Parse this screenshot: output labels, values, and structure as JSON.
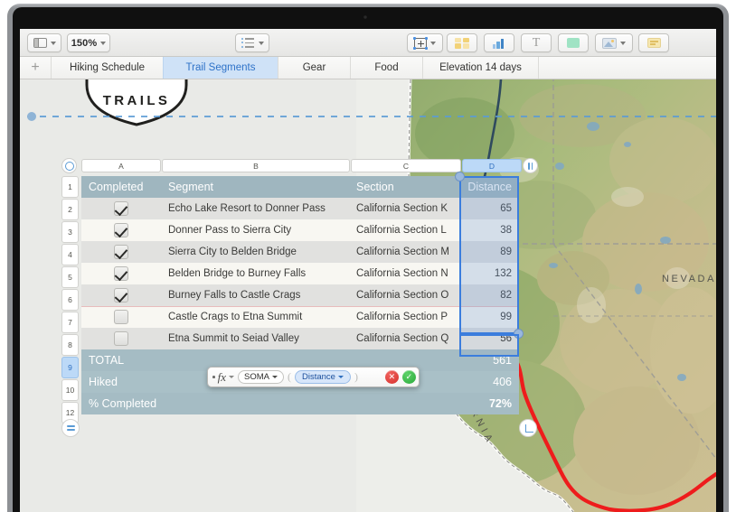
{
  "app": {
    "toolbar": {
      "view_label": "view-options",
      "zoom_value": "150%",
      "list_label": "format-list",
      "insert_label": "insert-object",
      "table_label": "Table",
      "chart_label": "Chart",
      "text_label": "T",
      "shape_label": "Shape",
      "media_label": "Media",
      "comment_label": "Comment"
    },
    "tabs": {
      "add_label": "+",
      "items": [
        {
          "label": "Hiking Schedule",
          "selected": false
        },
        {
          "label": "Trail Segments",
          "selected": true
        },
        {
          "label": "Gear",
          "selected": false
        },
        {
          "label": "Food",
          "selected": false
        },
        {
          "label": "Elevation 14 days",
          "selected": false
        }
      ]
    }
  },
  "logo": {
    "text": "TRAILS"
  },
  "table": {
    "column_headers": [
      "A",
      "B",
      "C",
      "D"
    ],
    "selected_column": "D",
    "row_numbers": [
      "1",
      "2",
      "3",
      "4",
      "5",
      "6",
      "7",
      "8",
      "9",
      "10",
      "12"
    ],
    "selected_row_number": "9",
    "headers": {
      "completed": "Completed",
      "segment": "Segment",
      "section": "Section",
      "distance": "Distance"
    },
    "rows": [
      {
        "completed": true,
        "segment": "Echo Lake Resort to Donner Pass",
        "section": "California Section K",
        "distance": "65"
      },
      {
        "completed": true,
        "segment": "Donner Pass to Sierra City",
        "section": "California Section L",
        "distance": "38"
      },
      {
        "completed": true,
        "segment": "Sierra City to Belden Bridge",
        "section": "California Section M",
        "distance": "89"
      },
      {
        "completed": true,
        "segment": "Belden Bridge to Burney Falls",
        "section": "California Section N",
        "distance": "132"
      },
      {
        "completed": true,
        "segment": "Burney Falls to Castle Crags",
        "section": "California Section O",
        "distance": "82"
      },
      {
        "completed": false,
        "segment": "Castle Crags to Etna Summit",
        "section": "California Section P",
        "distance": "99"
      },
      {
        "completed": false,
        "segment": "Etna Summit to Seiad Valley",
        "section": "California Section Q",
        "distance": "56"
      }
    ],
    "footers": [
      {
        "label": "TOTAL",
        "value": "561"
      },
      {
        "label": "Hiked",
        "value": "406"
      },
      {
        "label": "% Completed",
        "value": "72%"
      }
    ]
  },
  "formula_bar": {
    "fx_label": "fx",
    "function_name": "SOMA",
    "argument": "Distance",
    "open_paren": "(",
    "close_paren": ")",
    "cancel_label": "✕",
    "accept_label": "✓"
  },
  "map": {
    "state_label_california": "CALIFORNIA",
    "state_label_nevada": "NEVADA",
    "route_color": "#ee1c1c"
  },
  "colors": {
    "header_fill": "#9fb6bf",
    "footer_fill": "#a5bcc4",
    "row_odd": "#e1e1df",
    "row_even": "#f8f7f2",
    "selection": "#3b7ddd",
    "tab_selected_bg": "#cfe2f7",
    "tab_selected_text": "#2e72c8"
  }
}
